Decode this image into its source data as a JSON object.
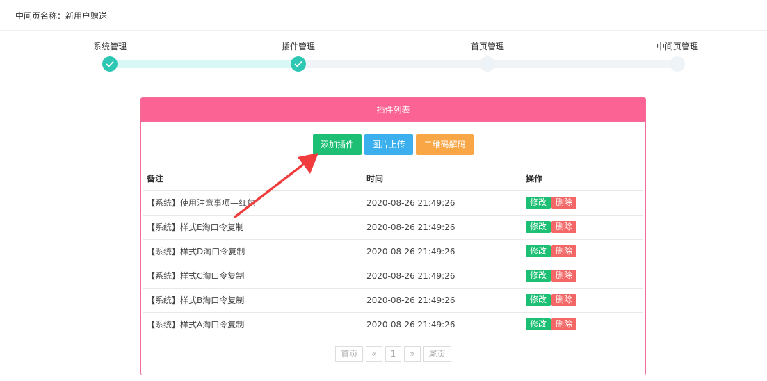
{
  "header": {
    "label": "中间页名称",
    "value": "新用户赠送"
  },
  "steps": [
    {
      "label": "系统管理",
      "done": true
    },
    {
      "label": "插件管理",
      "done": true
    },
    {
      "label": "首页管理",
      "done": false
    },
    {
      "label": "中间页管理",
      "done": false
    }
  ],
  "panel": {
    "title": "插件列表",
    "buttons": {
      "add": "添加插件",
      "upload": "图片上传",
      "qrcode": "二维码解码"
    },
    "columns": {
      "note": "备注",
      "time": "时间",
      "actions": "操作"
    },
    "rows": [
      {
        "note": "【系统】使用注意事项—红包",
        "time": "2020-08-26 21:49:26",
        "edit": "修改",
        "del": "删除"
      },
      {
        "note": "【系统】样式E淘口令复制",
        "time": "2020-08-26 21:49:26",
        "edit": "修改",
        "del": "删除"
      },
      {
        "note": "【系统】样式D淘口令复制",
        "time": "2020-08-26 21:49:26",
        "edit": "修改",
        "del": "删除"
      },
      {
        "note": "【系统】样式C淘口令复制",
        "time": "2020-08-26 21:49:26",
        "edit": "修改",
        "del": "删除"
      },
      {
        "note": "【系统】样式B淘口令复制",
        "time": "2020-08-26 21:49:26",
        "edit": "修改",
        "del": "删除"
      },
      {
        "note": "【系统】样式A淘口令复制",
        "time": "2020-08-26 21:49:26",
        "edit": "修改",
        "del": "删除"
      }
    ],
    "pager": {
      "first": "首页",
      "prev": "«",
      "current": "1",
      "next": "»",
      "last": "尾页"
    }
  },
  "colors": {
    "accent_pink": "#fb6394",
    "step_done": "#2ec7b3",
    "btn_green": "#1cbf73",
    "btn_blue": "#3cb0ef",
    "btn_orange": "#f9a646",
    "btn_red": "#f46767",
    "arrow_red": "#f03c3c"
  }
}
